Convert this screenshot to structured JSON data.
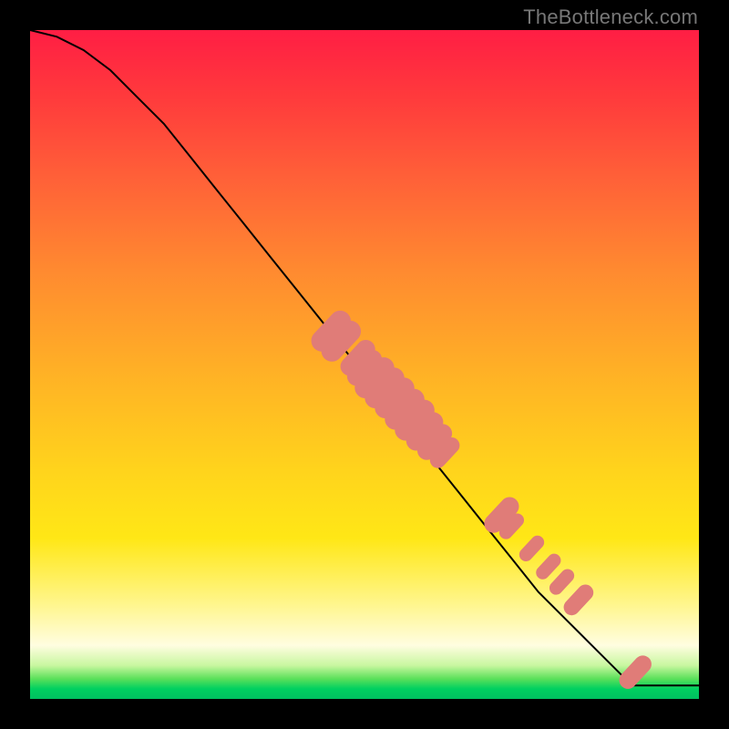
{
  "attribution": "TheBottleneck.com",
  "colors": {
    "dot": "#e07c78",
    "line": "#000000"
  },
  "chart_data": {
    "type": "line",
    "title": "",
    "xlabel": "",
    "ylabel": "",
    "xlim": [
      0,
      100
    ],
    "ylim": [
      0,
      100
    ],
    "grid": false,
    "legend": false,
    "note": "Axes are unlabeled in the image; values are normalized 0–100 estimates read from pixel positions.",
    "series": [
      {
        "name": "curve",
        "x": [
          0,
          4,
          8,
          12,
          16,
          20,
          24,
          28,
          32,
          36,
          40,
          44,
          48,
          52,
          56,
          60,
          64,
          68,
          72,
          76,
          80,
          84,
          88,
          90,
          92,
          96,
          100
        ],
        "y": [
          100,
          99,
          97,
          94,
          90,
          86,
          81,
          76,
          71,
          66,
          61,
          56,
          51,
          46,
          41,
          36,
          31,
          26,
          21,
          16,
          12,
          8,
          4,
          2,
          2,
          2,
          2
        ]
      }
    ],
    "points": [
      {
        "x": 45.0,
        "y": 55.0,
        "r": 1.6
      },
      {
        "x": 46.5,
        "y": 53.5,
        "r": 1.6
      },
      {
        "x": 49.0,
        "y": 51.0,
        "r": 1.4
      },
      {
        "x": 50.0,
        "y": 49.5,
        "r": 1.4
      },
      {
        "x": 51.5,
        "y": 48.0,
        "r": 1.6
      },
      {
        "x": 53.0,
        "y": 46.5,
        "r": 1.6
      },
      {
        "x": 54.5,
        "y": 45.0,
        "r": 1.6
      },
      {
        "x": 56.0,
        "y": 43.3,
        "r": 1.6
      },
      {
        "x": 57.5,
        "y": 41.7,
        "r": 1.6
      },
      {
        "x": 59.0,
        "y": 40.0,
        "r": 1.5
      },
      {
        "x": 60.5,
        "y": 38.4,
        "r": 1.4
      },
      {
        "x": 62.0,
        "y": 36.8,
        "r": 1.2
      },
      {
        "x": 70.5,
        "y": 27.5,
        "r": 1.4
      },
      {
        "x": 72.0,
        "y": 25.8,
        "r": 1.0
      },
      {
        "x": 75.0,
        "y": 22.5,
        "r": 1.0
      },
      {
        "x": 77.5,
        "y": 19.8,
        "r": 1.0
      },
      {
        "x": 79.5,
        "y": 17.5,
        "r": 1.0
      },
      {
        "x": 82.0,
        "y": 14.8,
        "r": 1.2
      },
      {
        "x": 90.5,
        "y": 4.0,
        "r": 1.3
      }
    ]
  }
}
